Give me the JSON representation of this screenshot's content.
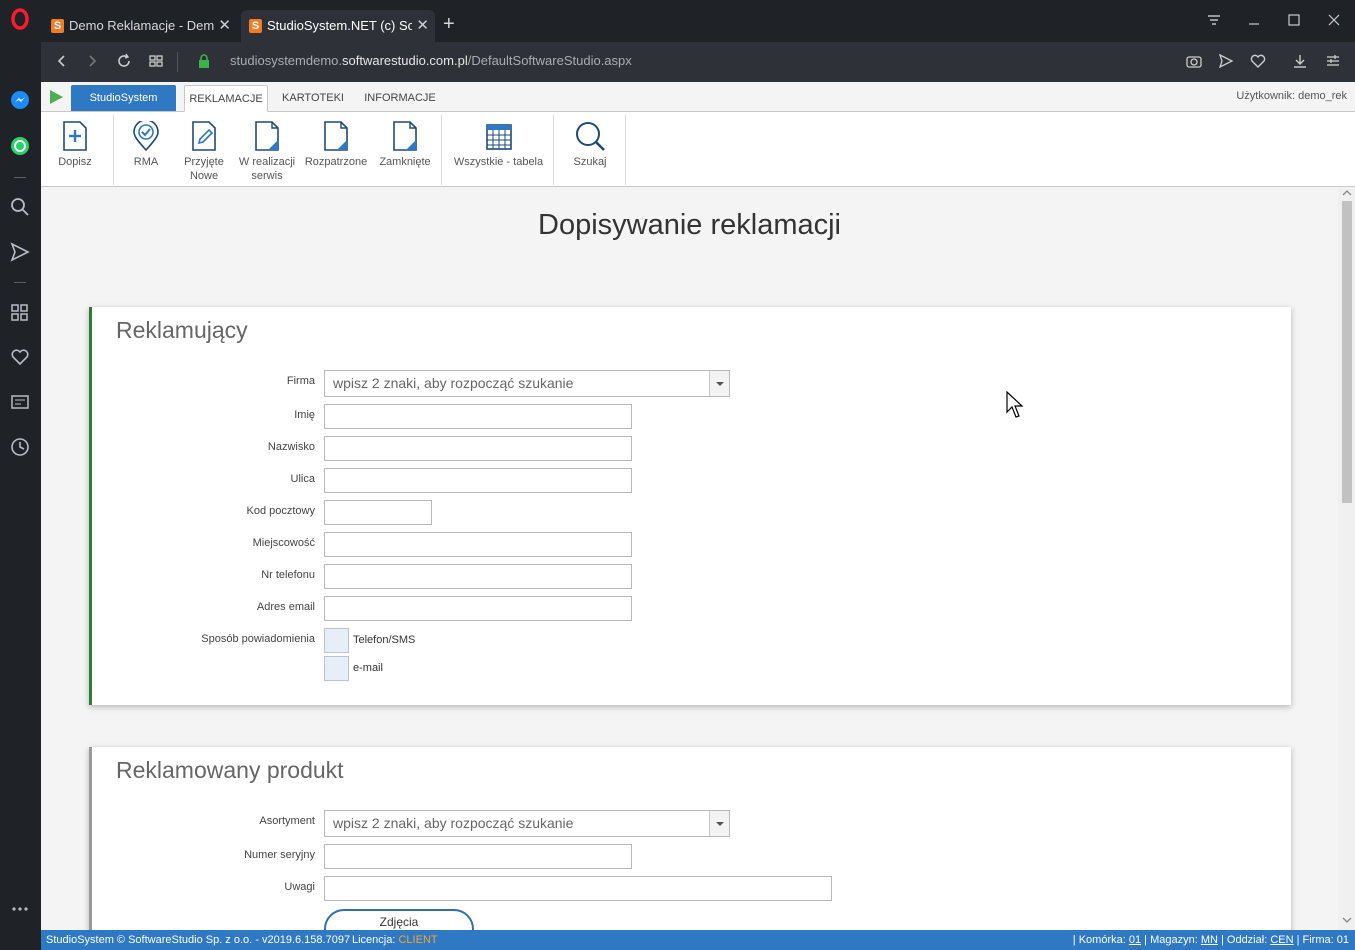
{
  "browser": {
    "tabs": [
      {
        "title": "Demo Reklamacje - Demo"
      },
      {
        "title": "StudioSystem.NET (c) SoftwareStudio"
      }
    ],
    "favicon_letter": "S",
    "new_tab_symbol": "+",
    "close_symbol": "✕",
    "url_prefix": "studiosystemdemo.",
    "url_domain": "softwarestudio.com.pl",
    "url_path": "/DefaultSoftwareStudio.aspx"
  },
  "app": {
    "brand_tab": "StudioSystem",
    "tabs": [
      "REKLAMACJE",
      "KARTOTEKI",
      "INFORMACJE"
    ],
    "user_label": "Użytkownik: demo_rek",
    "ribbon": [
      {
        "label": "Dopisz",
        "icon": "add-document-icon"
      },
      {
        "label": "RMA",
        "icon": "location-pin-check-icon"
      },
      {
        "label": "Przyjęte",
        "label2": "Nowe",
        "icon": "edit-document-icon"
      },
      {
        "label": "W realizacji",
        "label2": "serwis",
        "icon": "document-icon"
      },
      {
        "label": "Rozpatrzone",
        "icon": "document-icon"
      },
      {
        "label": "Zamknięte",
        "icon": "document-icon"
      },
      {
        "label": "Wszystkie - tabela",
        "icon": "table-icon"
      },
      {
        "label": "Szukaj",
        "icon": "search-icon"
      }
    ]
  },
  "page": {
    "title": "Dopisywanie reklamacji"
  },
  "reklamujacy": {
    "heading": "Reklamujący",
    "firma_label": "Firma",
    "firma_placeholder": "wpisz 2 znaki, aby rozpocząć szukanie",
    "fields": {
      "imie": "Imię",
      "nazwisko": "Nazwisko",
      "ulica": "Ulica",
      "kod": "Kod pocztowy",
      "miejscowosc": "Miejscowość",
      "telefon": "Nr telefonu",
      "email": "Adres email"
    },
    "notify_label": "Sposób powiadomienia",
    "notify_options": [
      "Telefon/SMS",
      "e-mail"
    ]
  },
  "produkt": {
    "heading": "Reklamowany produkt",
    "asortyment_label": "Asortyment",
    "asortyment_placeholder": "wpisz 2 znaki, aby rozpocząć szukanie",
    "serial_label": "Numer seryjny",
    "uwagi_label": "Uwagi",
    "photos_button": "Zdjęcia"
  },
  "status": {
    "left": "StudioSystem © SoftwareStudio Sp. z o.o. - v2019.6.158.7097",
    "license_label": "Licencja: ",
    "license_value": "CLIENT",
    "komorka_label": "| Komórka: ",
    "komorka": "01",
    "magazyn_label": " | Magazyn: ",
    "magazyn": "MN",
    "oddzial_label": " | Oddział: ",
    "oddzial": "CEN",
    "firma_label": " | Firma: ",
    "firma": "01"
  },
  "colors": {
    "accent": "#2f78c4",
    "license": "#f5a623",
    "section_active": "#2e7d32"
  }
}
